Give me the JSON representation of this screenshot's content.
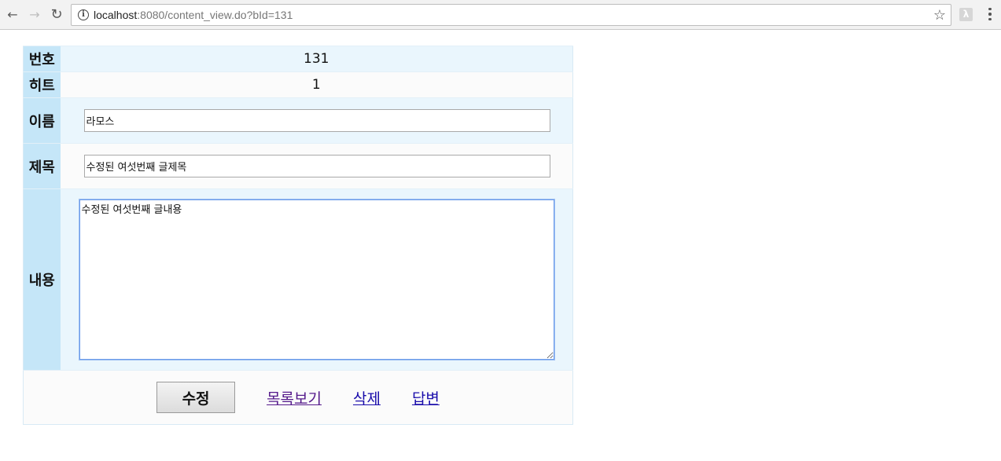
{
  "browser": {
    "url_host": "localhost",
    "url_rest": ":8080/content_view.do?bId=131"
  },
  "form": {
    "number_label": "번호",
    "number_value": "131",
    "hit_label": "히트",
    "hit_value": "1",
    "name_label": "이름",
    "name_value": "라모스",
    "title_label": "제목",
    "title_value": "수정된 여섯번째 글제목",
    "content_label": "내용",
    "content_value": "수정된 여섯번째 글내용"
  },
  "actions": {
    "submit_label": "수정",
    "list_label": "목록보기",
    "delete_label": "삭제",
    "reply_label": "답변"
  }
}
